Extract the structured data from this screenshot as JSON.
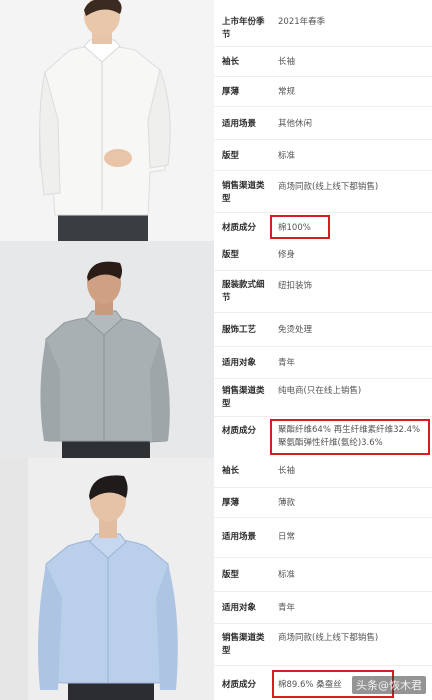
{
  "panels": [
    {
      "photo_bg": "#f4f4f4",
      "rows": [
        {
          "label": "上市年份季节",
          "value": "2021年春季"
        },
        {
          "label": "袖长",
          "value": "长袖"
        },
        {
          "label": "厚薄",
          "value": "常规"
        },
        {
          "label": "适用场景",
          "value": "其他休闲"
        },
        {
          "label": "版型",
          "value": "标准"
        },
        {
          "label": "销售渠道类型",
          "value": "商场同款(线上线下都销售)"
        },
        {
          "label": "材质成分",
          "value": "棉100%"
        }
      ]
    },
    {
      "photo_bg": "#e7e8e9",
      "rows": [
        {
          "label": "版型",
          "value": "修身"
        },
        {
          "label": "服装款式细节",
          "value": "纽扣装饰"
        },
        {
          "label": "服饰工艺",
          "value": "免烫处理"
        },
        {
          "label": "适用对象",
          "value": "青年"
        },
        {
          "label": "销售渠道类型",
          "value": "纯电商(只在线上销售)"
        },
        {
          "label": "材质成分",
          "value": "聚酯纤维64% 再生纤维素纤维32.4% 聚氨酯弹性纤维(氨纶)3.6%"
        }
      ]
    },
    {
      "photo_bg": "#eeeeee",
      "rows": [
        {
          "label": "袖长",
          "value": "长袖"
        },
        {
          "label": "厚薄",
          "value": "薄款"
        },
        {
          "label": "适用场景",
          "value": "日常"
        },
        {
          "label": "版型",
          "value": "标准"
        },
        {
          "label": "适用对象",
          "value": "青年"
        },
        {
          "label": "销售渠道类型",
          "value": "商场同款(线上线下都销售)"
        },
        {
          "label": "材质成分",
          "value": "棉89.6% 桑蚕丝"
        }
      ]
    }
  ],
  "watermark": "头条@恢木君",
  "colors": {
    "highlight": "#d71c24",
    "shirt1": "#f7f7f5",
    "shirt2": "#a9b0b3",
    "shirt3": "#b9cfea"
  }
}
